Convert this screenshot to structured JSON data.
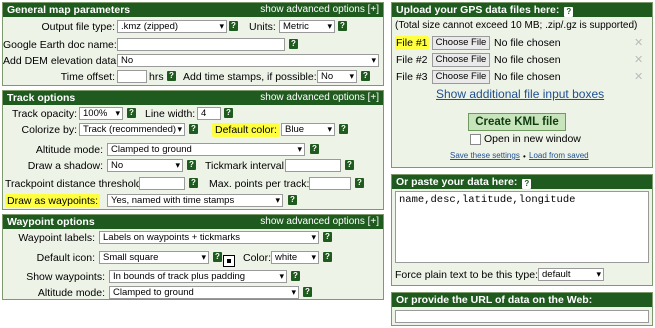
{
  "general": {
    "title": "General map parameters",
    "advanced": "show advanced options [+]",
    "output_label": "Output file type:",
    "output_value": ".kmz (zipped)",
    "units_label": "Units:",
    "units_value": "Metric",
    "doc_name_label": "Google Earth doc name:",
    "dem_label": "Add DEM elevation data:",
    "dem_value": "No",
    "offset_label": "Time offset:",
    "offset_unit": "hrs",
    "timestamps_label": "Add time stamps, if possible:",
    "timestamps_value": "No"
  },
  "track": {
    "title": "Track options",
    "advanced": "show advanced options [+]",
    "opacity_label": "Track opacity:",
    "opacity_value": "100%",
    "linewidth_label": "Line width:",
    "linewidth_value": "4",
    "colorize_label": "Colorize by:",
    "colorize_value": "Track (recommended)",
    "default_color_label": "Default color:",
    "default_color_value": "Blue",
    "altitude_label": "Altitude mode:",
    "altitude_value": "Clamped to ground",
    "shadow_label": "Draw a shadow:",
    "shadow_value": "No",
    "tick_label": "Tickmark interval:",
    "distance_label": "Trackpoint distance threshold:",
    "maxpoints_label": "Max. points per track:",
    "waypoints_label": "Draw as waypoints:",
    "waypoints_value": "Yes, named with time stamps"
  },
  "waypoint": {
    "title": "Waypoint options",
    "advanced": "show advanced options [+]",
    "labels_label": "Waypoint labels:",
    "labels_value": "Labels on waypoints + tickmarks",
    "icon_label": "Default icon:",
    "icon_value": "Small square",
    "color_label": "Color:",
    "color_value": "white",
    "show_label": "Show waypoints:",
    "show_value": "In bounds of track plus padding",
    "altitude_label": "Altitude mode:",
    "altitude_value": "Clamped to ground"
  },
  "upload": {
    "title": "Upload your GPS data files here:",
    "limit": "(Total size cannot exceed 10 MB; .zip/.gz is supported)",
    "files": [
      {
        "label": "File #1",
        "button": "Choose File",
        "status": "No file chosen"
      },
      {
        "label": "File #2",
        "button": "Choose File",
        "status": "No file chosen"
      },
      {
        "label": "File #3",
        "button": "Choose File",
        "status": "No file chosen"
      }
    ],
    "more": "Show additional file input boxes",
    "create": "Create KML file",
    "new_window": "Open in new window",
    "save": "Save these settings",
    "sep": "•",
    "load": "Load from saved"
  },
  "paste": {
    "title": "Or paste your data here:",
    "content": "name,desc,latitude,longitude",
    "force_label": "Force plain text to be this type:",
    "force_value": "default"
  },
  "url": {
    "title": "Or provide the URL of data on the Web:"
  },
  "help_glyph": "?",
  "clear_glyph": "✕",
  "colors": {
    "header": "#1f5a1f",
    "panel": "#eef3e8",
    "highlight": "#ffff40",
    "link": "#1f4f8f"
  }
}
